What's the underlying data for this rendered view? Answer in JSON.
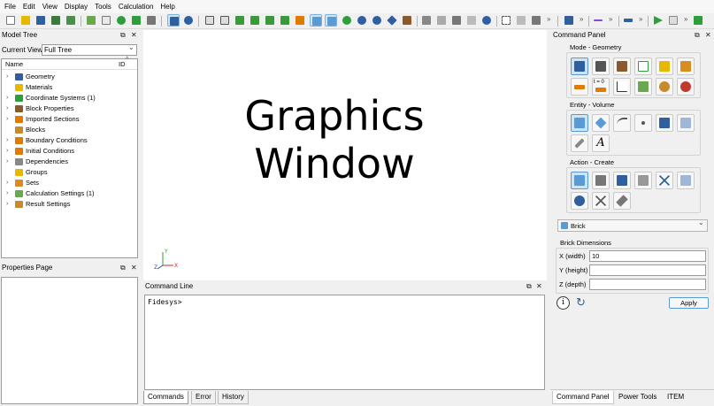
{
  "menu": [
    "File",
    "Edit",
    "View",
    "Display",
    "Tools",
    "Calculation",
    "Help"
  ],
  "colors": {
    "accent": "#5b9bd5",
    "geometry_blue": "#2f5f9e",
    "green": "#2e9e3a",
    "yellow": "#e6b800",
    "orange": "#e07b00",
    "brown": "#8a5a2b"
  },
  "model_tree": {
    "title": "Model Tree",
    "current_view_label": "Current View",
    "current_view_value": "Full Tree",
    "col_name": "Name",
    "col_id": "ID",
    "items": [
      {
        "label": "Geometry",
        "icon": "geometry-icon",
        "expandable": true
      },
      {
        "label": "Materials",
        "icon": "materials-icon",
        "expandable": false
      },
      {
        "label": "Coordinate Systems (1)",
        "icon": "coordinate-system-icon",
        "expandable": true
      },
      {
        "label": "Block Properties",
        "icon": "block-properties-icon",
        "expandable": true
      },
      {
        "label": "Imported Sections",
        "icon": "imported-sections-icon",
        "expandable": true
      },
      {
        "label": "Blocks",
        "icon": "blocks-icon",
        "expandable": false
      },
      {
        "label": "Boundary Conditions",
        "icon": "boundary-conditions-icon",
        "expandable": true
      },
      {
        "label": "Initial Conditions",
        "icon": "initial-conditions-icon",
        "expandable": true
      },
      {
        "label": "Dependencies",
        "icon": "dependencies-icon",
        "expandable": true
      },
      {
        "label": "Groups",
        "icon": "groups-icon",
        "expandable": false
      },
      {
        "label": "Sets",
        "icon": "sets-icon",
        "expandable": true
      },
      {
        "label": "Calculation Settings (1)",
        "icon": "calculation-settings-icon",
        "expandable": true
      },
      {
        "label": "Result Settings",
        "icon": "result-settings-icon",
        "expandable": true
      }
    ]
  },
  "properties": {
    "title": "Properties Page"
  },
  "graphics": {
    "line1": "Graphics",
    "line2": "Window",
    "axis_x": "X",
    "axis_y": "Y",
    "axis_z": "Z"
  },
  "command_line": {
    "title": "Command Line",
    "prompt": "Fidesys>",
    "tabs": [
      "Commands",
      "Error",
      "History"
    ]
  },
  "command_panel": {
    "title": "Command Panel",
    "mode_label": "Mode - Geometry",
    "entity_label": "Entity - Volume",
    "action_label": "Action - Create",
    "t0_label": "t = 0",
    "text_icon_label": "A",
    "shape_value": "Brick",
    "dims_label": "Brick Dimensions",
    "x_label": "X (width)",
    "x_value": "10",
    "y_label": "Y (height)",
    "y_value": "",
    "z_label": "Z (depth)",
    "z_value": "",
    "apply_label": "Apply",
    "tabs": [
      "Command Panel",
      "Power Tools",
      "ITEM"
    ]
  },
  "symbols": {
    "float": "⧉",
    "close": "✕",
    "expand": "›",
    "dropdown": "⌄",
    "more": "»",
    "info": "i",
    "reset": "↻",
    "sort": "^"
  }
}
